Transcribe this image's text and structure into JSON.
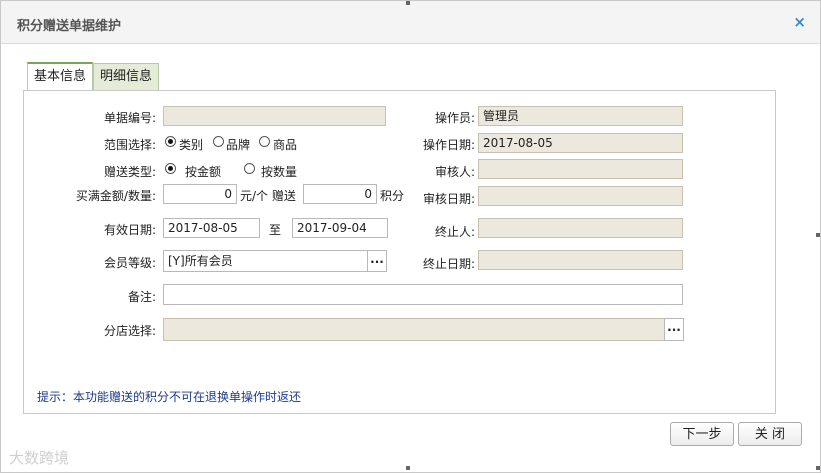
{
  "dialog": {
    "title": "积分赠送单据维护",
    "close_glyph": "×"
  },
  "tabs": [
    {
      "label": "基本信息"
    },
    {
      "label": "明细信息"
    }
  ],
  "form": {
    "doc_no": {
      "label": "单据编号:",
      "value": ""
    },
    "scope": {
      "label": "范围选择:",
      "options": [
        "类别",
        "品牌",
        "商品"
      ],
      "selected": "类别"
    },
    "gift_type": {
      "label": "赠送类型:",
      "options": [
        "按金额",
        "按数量"
      ],
      "selected": "按金额"
    },
    "threshold": {
      "label": "买满金额/数量:",
      "amount": "0",
      "unit_text": "元/个 赠送",
      "points": "0",
      "points_unit": "积分"
    },
    "valid_date": {
      "label": "有效日期:",
      "start": "2017-08-05",
      "sep": "至",
      "end": "2017-09-04"
    },
    "member_level": {
      "label": "会员等级:",
      "value": "[Y]所有会员",
      "picker": "..."
    },
    "remark": {
      "label": "备注:",
      "value": ""
    },
    "store": {
      "label": "分店选择:",
      "value": "",
      "picker": "..."
    },
    "operator": {
      "label": "操作员:",
      "value": "管理员"
    },
    "op_date": {
      "label": "操作日期:",
      "value": "2017-08-05"
    },
    "reviewer": {
      "label": "审核人:",
      "value": ""
    },
    "review_date": {
      "label": "审核日期:",
      "value": ""
    },
    "terminator": {
      "label": "终止人:",
      "value": ""
    },
    "terminate_date": {
      "label": "终止日期:",
      "value": ""
    }
  },
  "hint": "提示：本功能赠送的积分不可在退换单操作时返还",
  "buttons": {
    "next": "下一步",
    "close": "关 闭"
  },
  "watermark": "大数跨境",
  "colors": {
    "readonly_bg": "#ede8dd",
    "hint": "#1e3a8c",
    "close_icon": "#3a87c8",
    "tab_accent": "#7aa35a"
  }
}
